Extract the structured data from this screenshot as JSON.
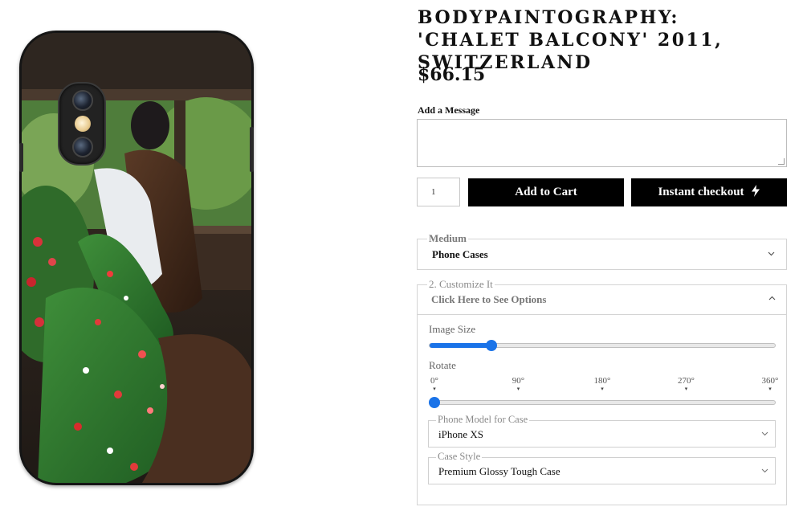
{
  "product": {
    "title": "BODYPAINTOGRAPHY: 'CHALET BALCONY' 2011, SWITZERLAND",
    "price": "$66.15"
  },
  "message": {
    "label": "Add a Message",
    "value": ""
  },
  "purchase": {
    "quantity": "1",
    "add_to_cart_label": "Add to Cart",
    "instant_checkout_label": "Instant checkout",
    "instant_icon": "lightning-bolt-icon"
  },
  "options": {
    "medium": {
      "legend": "Medium",
      "value": "Phone Cases"
    },
    "customize": {
      "legend": "2. Customize It",
      "value": "Click Here to See Options",
      "expanded": true,
      "image_size": {
        "label": "Image Size",
        "value_fraction": 0.18
      },
      "rotate": {
        "label": "Rotate",
        "ticks": [
          "0°",
          "90°",
          "180°",
          "270°",
          "360°"
        ],
        "value_degrees": 0
      },
      "phone_model": {
        "legend": "Phone Model for Case",
        "value": "iPhone XS"
      },
      "case_style": {
        "legend": "Case Style",
        "value": "Premium Glossy Tough Case"
      }
    }
  },
  "icons": {
    "chevron_down": "⌄",
    "chevron_up": "⌃",
    "bolt": "⚡",
    "tick_marker": "▾"
  },
  "colors": {
    "button_bg": "#000000",
    "slider_accent": "#1a73e8",
    "case_body": "#151515"
  }
}
